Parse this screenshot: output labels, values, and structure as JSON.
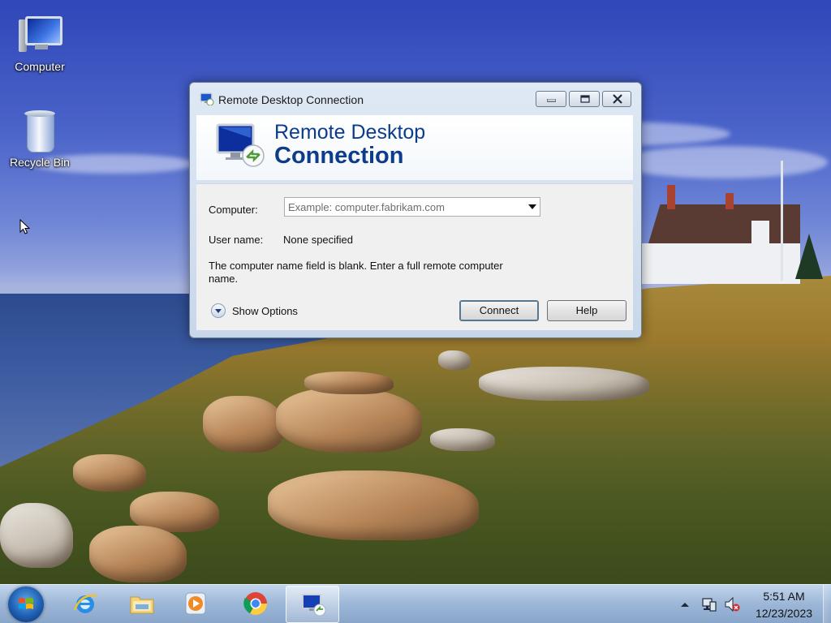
{
  "desktop": {
    "icons": [
      {
        "label": "Computer",
        "icon": "computer-icon"
      },
      {
        "label": "Recycle Bin",
        "icon": "recycle-bin-icon"
      }
    ]
  },
  "dialog": {
    "title": "Remote Desktop Connection",
    "banner_line1": "Remote Desktop",
    "banner_line2": "Connection",
    "computer_label": "Computer:",
    "computer_placeholder": "Example: computer.fabrikam.com",
    "computer_value": "",
    "username_label": "User name:",
    "username_value": "None specified",
    "message": "The computer name field is blank. Enter a full remote computer name.",
    "show_options_label": "Show Options",
    "connect_label": "Connect",
    "help_label": "Help"
  },
  "taskbar": {
    "pinned": [
      {
        "name": "internet-explorer",
        "icon": "internet-explorer-icon"
      },
      {
        "name": "windows-explorer",
        "icon": "folder-icon"
      },
      {
        "name": "media-player",
        "icon": "media-player-icon"
      },
      {
        "name": "chrome",
        "icon": "chrome-icon"
      },
      {
        "name": "remote-desktop",
        "icon": "remote-desktop-icon",
        "active": true
      }
    ],
    "clock": {
      "time": "5:51 AM",
      "date": "12/23/2023"
    }
  },
  "colors": {
    "banner_title": "#0c3c8a",
    "taskbar": "#96b2d4"
  }
}
